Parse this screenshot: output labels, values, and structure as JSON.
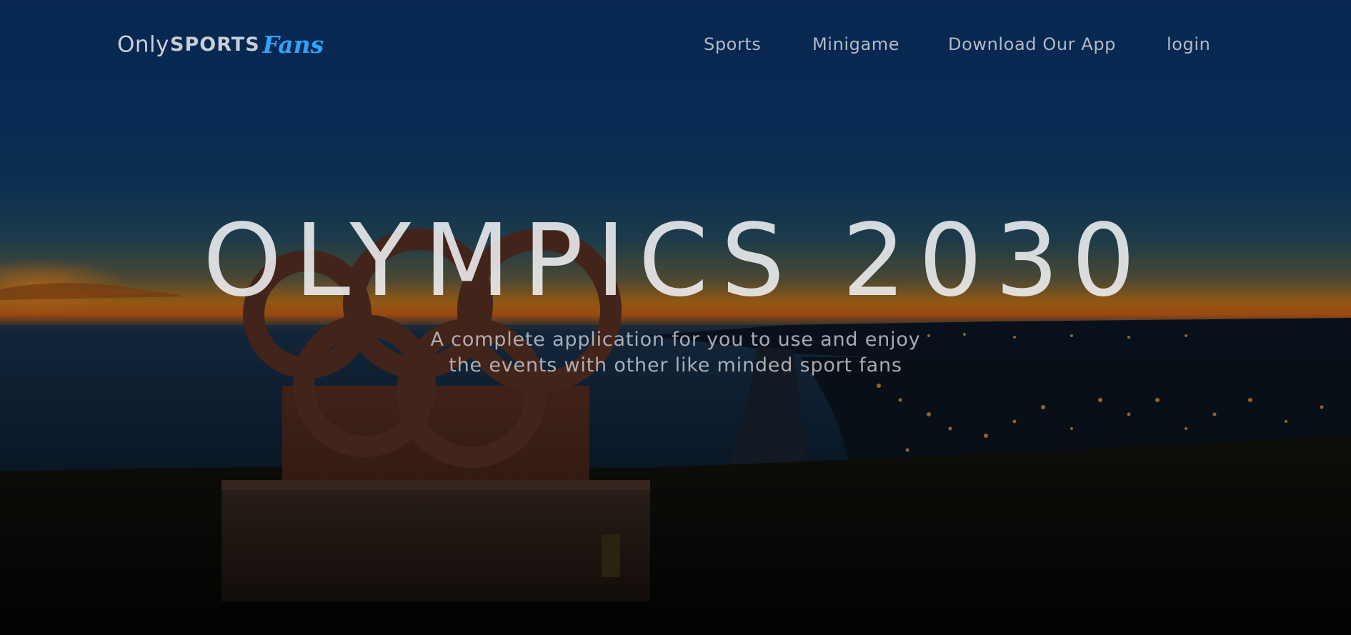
{
  "logo": {
    "part1": "Only",
    "part2": "SPORTS",
    "part3": "Fans",
    "accent_color": "#2ea2ff"
  },
  "nav": {
    "items": [
      {
        "label": "Sports"
      },
      {
        "label": "Minigame"
      },
      {
        "label": "Download Our App"
      },
      {
        "label": "login"
      }
    ]
  },
  "hero": {
    "title": "OLYMPICS 2030",
    "subtitle_line1": "A complete application for you to use and enjoy",
    "subtitle_line2": "the events with other like minded sport fans",
    "background": "olympic-rings-sunset-coast-photo"
  }
}
